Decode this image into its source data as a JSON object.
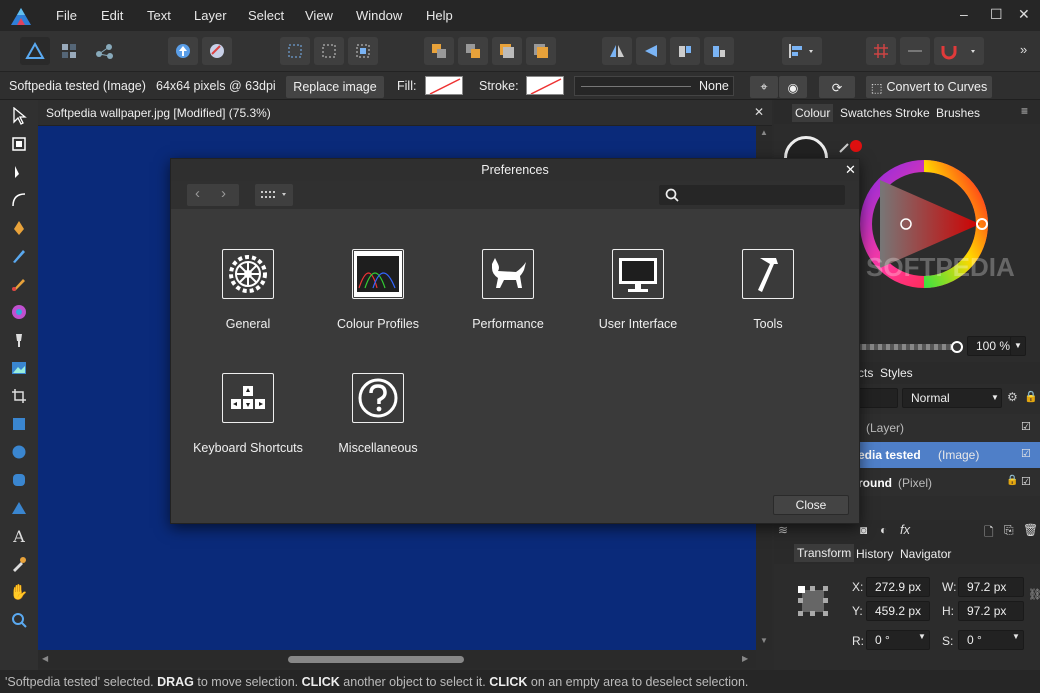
{
  "menu": [
    "File",
    "Edit",
    "Text",
    "Layer",
    "Select",
    "View",
    "Window",
    "Help"
  ],
  "context": {
    "object_name": "Softpedia tested (Image)",
    "size_info": "64x64 pixels @ 63dpi",
    "replace_label": "Replace image",
    "fill_label": "Fill:",
    "stroke_label": "Stroke:",
    "stroke_value": "None",
    "convert_label": "Convert to Curves"
  },
  "document_tab": "Softpedia wallpaper.jpg [Modified] (75.3%)",
  "dialog": {
    "title": "Preferences",
    "items": [
      {
        "label": "General",
        "icon": "gear-icon"
      },
      {
        "label": "Colour Profiles",
        "icon": "colour-profiles-icon"
      },
      {
        "label": "Performance",
        "icon": "cat-icon"
      },
      {
        "label": "User Interface",
        "icon": "monitor-icon"
      },
      {
        "label": "Tools",
        "icon": "hammer-icon"
      },
      {
        "label": "Keyboard Shortcuts",
        "icon": "keyboard-icon"
      },
      {
        "label": "Miscellaneous",
        "icon": "question-icon"
      }
    ],
    "close_label": "Close"
  },
  "colour_panel": {
    "tabs": [
      "Colour",
      "Swatches",
      "Stroke",
      "Brushes"
    ],
    "opacity": "100 %",
    "watermark": "SOFTPEDIA"
  },
  "layers_panel": {
    "tabs_partial": "cts",
    "styles_tab": "Styles",
    "blend_mode": "Normal",
    "layers": [
      {
        "name": "l",
        "type": "(Layer)"
      },
      {
        "name": "edia tested",
        "type": "(Image)"
      },
      {
        "name": "round",
        "type": "(Pixel)"
      }
    ]
  },
  "transform_panel": {
    "tabs": [
      "Transform",
      "History",
      "Navigator"
    ],
    "x_label": "X:",
    "x": "272.9 px",
    "y_label": "Y:",
    "y": "459.2 px",
    "w_label": "W:",
    "w": "97.2 px",
    "h_label": "H:",
    "h": "97.2 px",
    "r_label": "R:",
    "r": "0 °",
    "s_label": "S:",
    "s": "0 °"
  },
  "status": {
    "p1": "'Softpedia tested' selected. ",
    "p2": "DRAG",
    "p3": " to move selection. ",
    "p4": "CLICK",
    "p5": " another object to select it. ",
    "p6": "CLICK",
    "p7": " on an empty area to deselect selection."
  }
}
